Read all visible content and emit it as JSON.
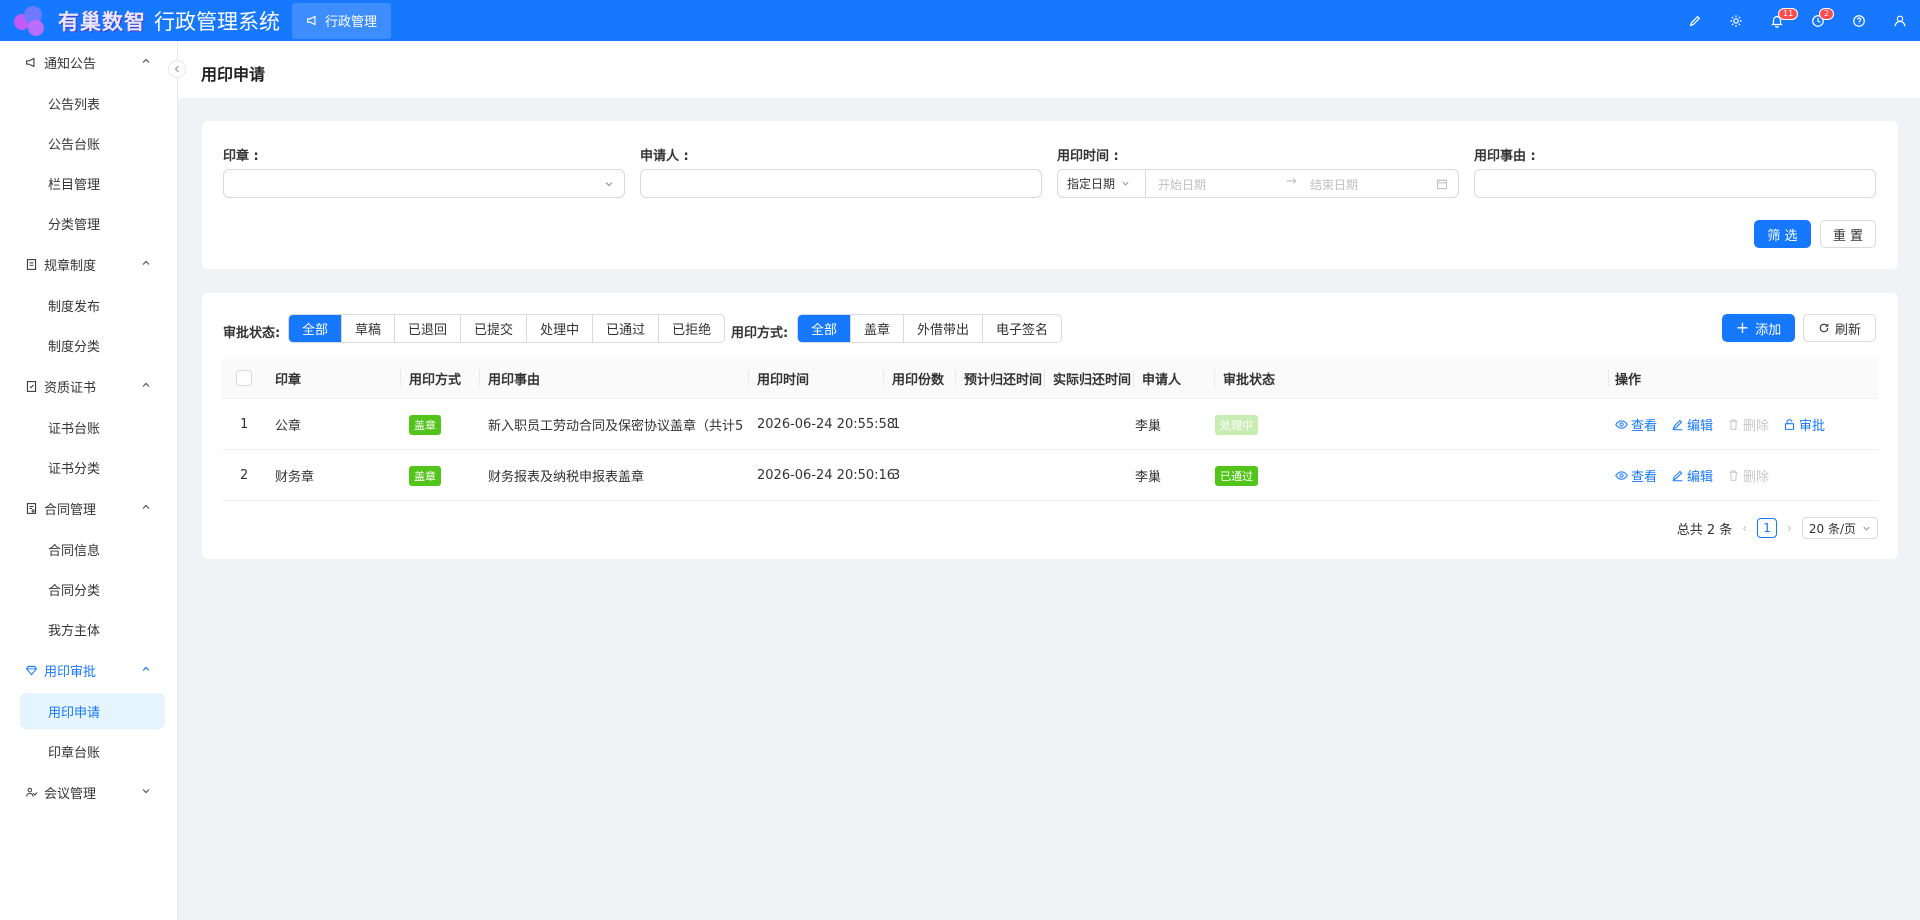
{
  "header": {
    "logo_text": "有巢数智",
    "system_title": "行政管理系统",
    "active_tab": "行政管理",
    "notifications_badge": "11",
    "tasks_badge": "2"
  },
  "sidebar": {
    "groups": [
      {
        "label": "通知公告",
        "items": [
          "公告列表",
          "公告台账",
          "栏目管理",
          "分类管理"
        ]
      },
      {
        "label": "规章制度",
        "items": [
          "制度发布",
          "制度分类"
        ]
      },
      {
        "label": "资质证书",
        "items": [
          "证书台账",
          "证书分类"
        ]
      },
      {
        "label": "合同管理",
        "items": [
          "合同信息",
          "合同分类",
          "我方主体"
        ]
      },
      {
        "label": "用印审批",
        "items": [
          "用印申请",
          "印章台账"
        ]
      },
      {
        "label": "会议管理",
        "items": []
      }
    ]
  },
  "page": {
    "title": "用印申请"
  },
  "filters": {
    "seal_label": "印章 :",
    "applicant_label": "申请人 :",
    "time_label": "用印时间 :",
    "time_mode": "指定日期",
    "start_placeholder": "开始日期",
    "end_placeholder": "结束日期",
    "reason_label": "用印事由 :",
    "filter_button": "筛 选",
    "reset_button": "重 置"
  },
  "status_filter": {
    "label": "审批状态:",
    "options": [
      "全部",
      "草稿",
      "已退回",
      "已提交",
      "处理中",
      "已通过",
      "已拒绝"
    ],
    "selected": "全部"
  },
  "method_filter": {
    "label": "用印方式:",
    "options": [
      "全部",
      "盖章",
      "外借带出",
      "电子签名"
    ],
    "selected": "全部"
  },
  "toolbar": {
    "add_label": "添加",
    "refresh_label": "刷新"
  },
  "table": {
    "columns": [
      "印章",
      "用印方式",
      "用印事由",
      "用印时间",
      "用印份数",
      "预计归还时间",
      "实际归还时间",
      "申请人",
      "审批状态",
      "操作"
    ],
    "rows": [
      {
        "index": "1",
        "seal": "公章",
        "method": "盖章",
        "reason": "新入职员工劳动合同及保密协议盖章（共计5...",
        "time": "2026-06-24 20:55:58",
        "copies": "1",
        "expected_return": "",
        "actual_return": "",
        "applicant": "李巢",
        "status": "处理中",
        "actions": [
          "查看",
          "编辑",
          "删除",
          "审批"
        ]
      },
      {
        "index": "2",
        "seal": "财务章",
        "method": "盖章",
        "reason": "财务报表及纳税申报表盖章",
        "time": "2026-06-24 20:50:16",
        "copies": "3",
        "expected_return": "",
        "actual_return": "",
        "applicant": "李巢",
        "status": "已通过",
        "actions": [
          "查看",
          "编辑",
          "删除"
        ]
      }
    ]
  },
  "pagination": {
    "total_text": "总共 2 条",
    "current_page": "1",
    "page_size": "20 条/页"
  },
  "colors": {
    "primary": "#1677ff",
    "success": "#52c41a",
    "processing_tag": "#c8edb3"
  }
}
